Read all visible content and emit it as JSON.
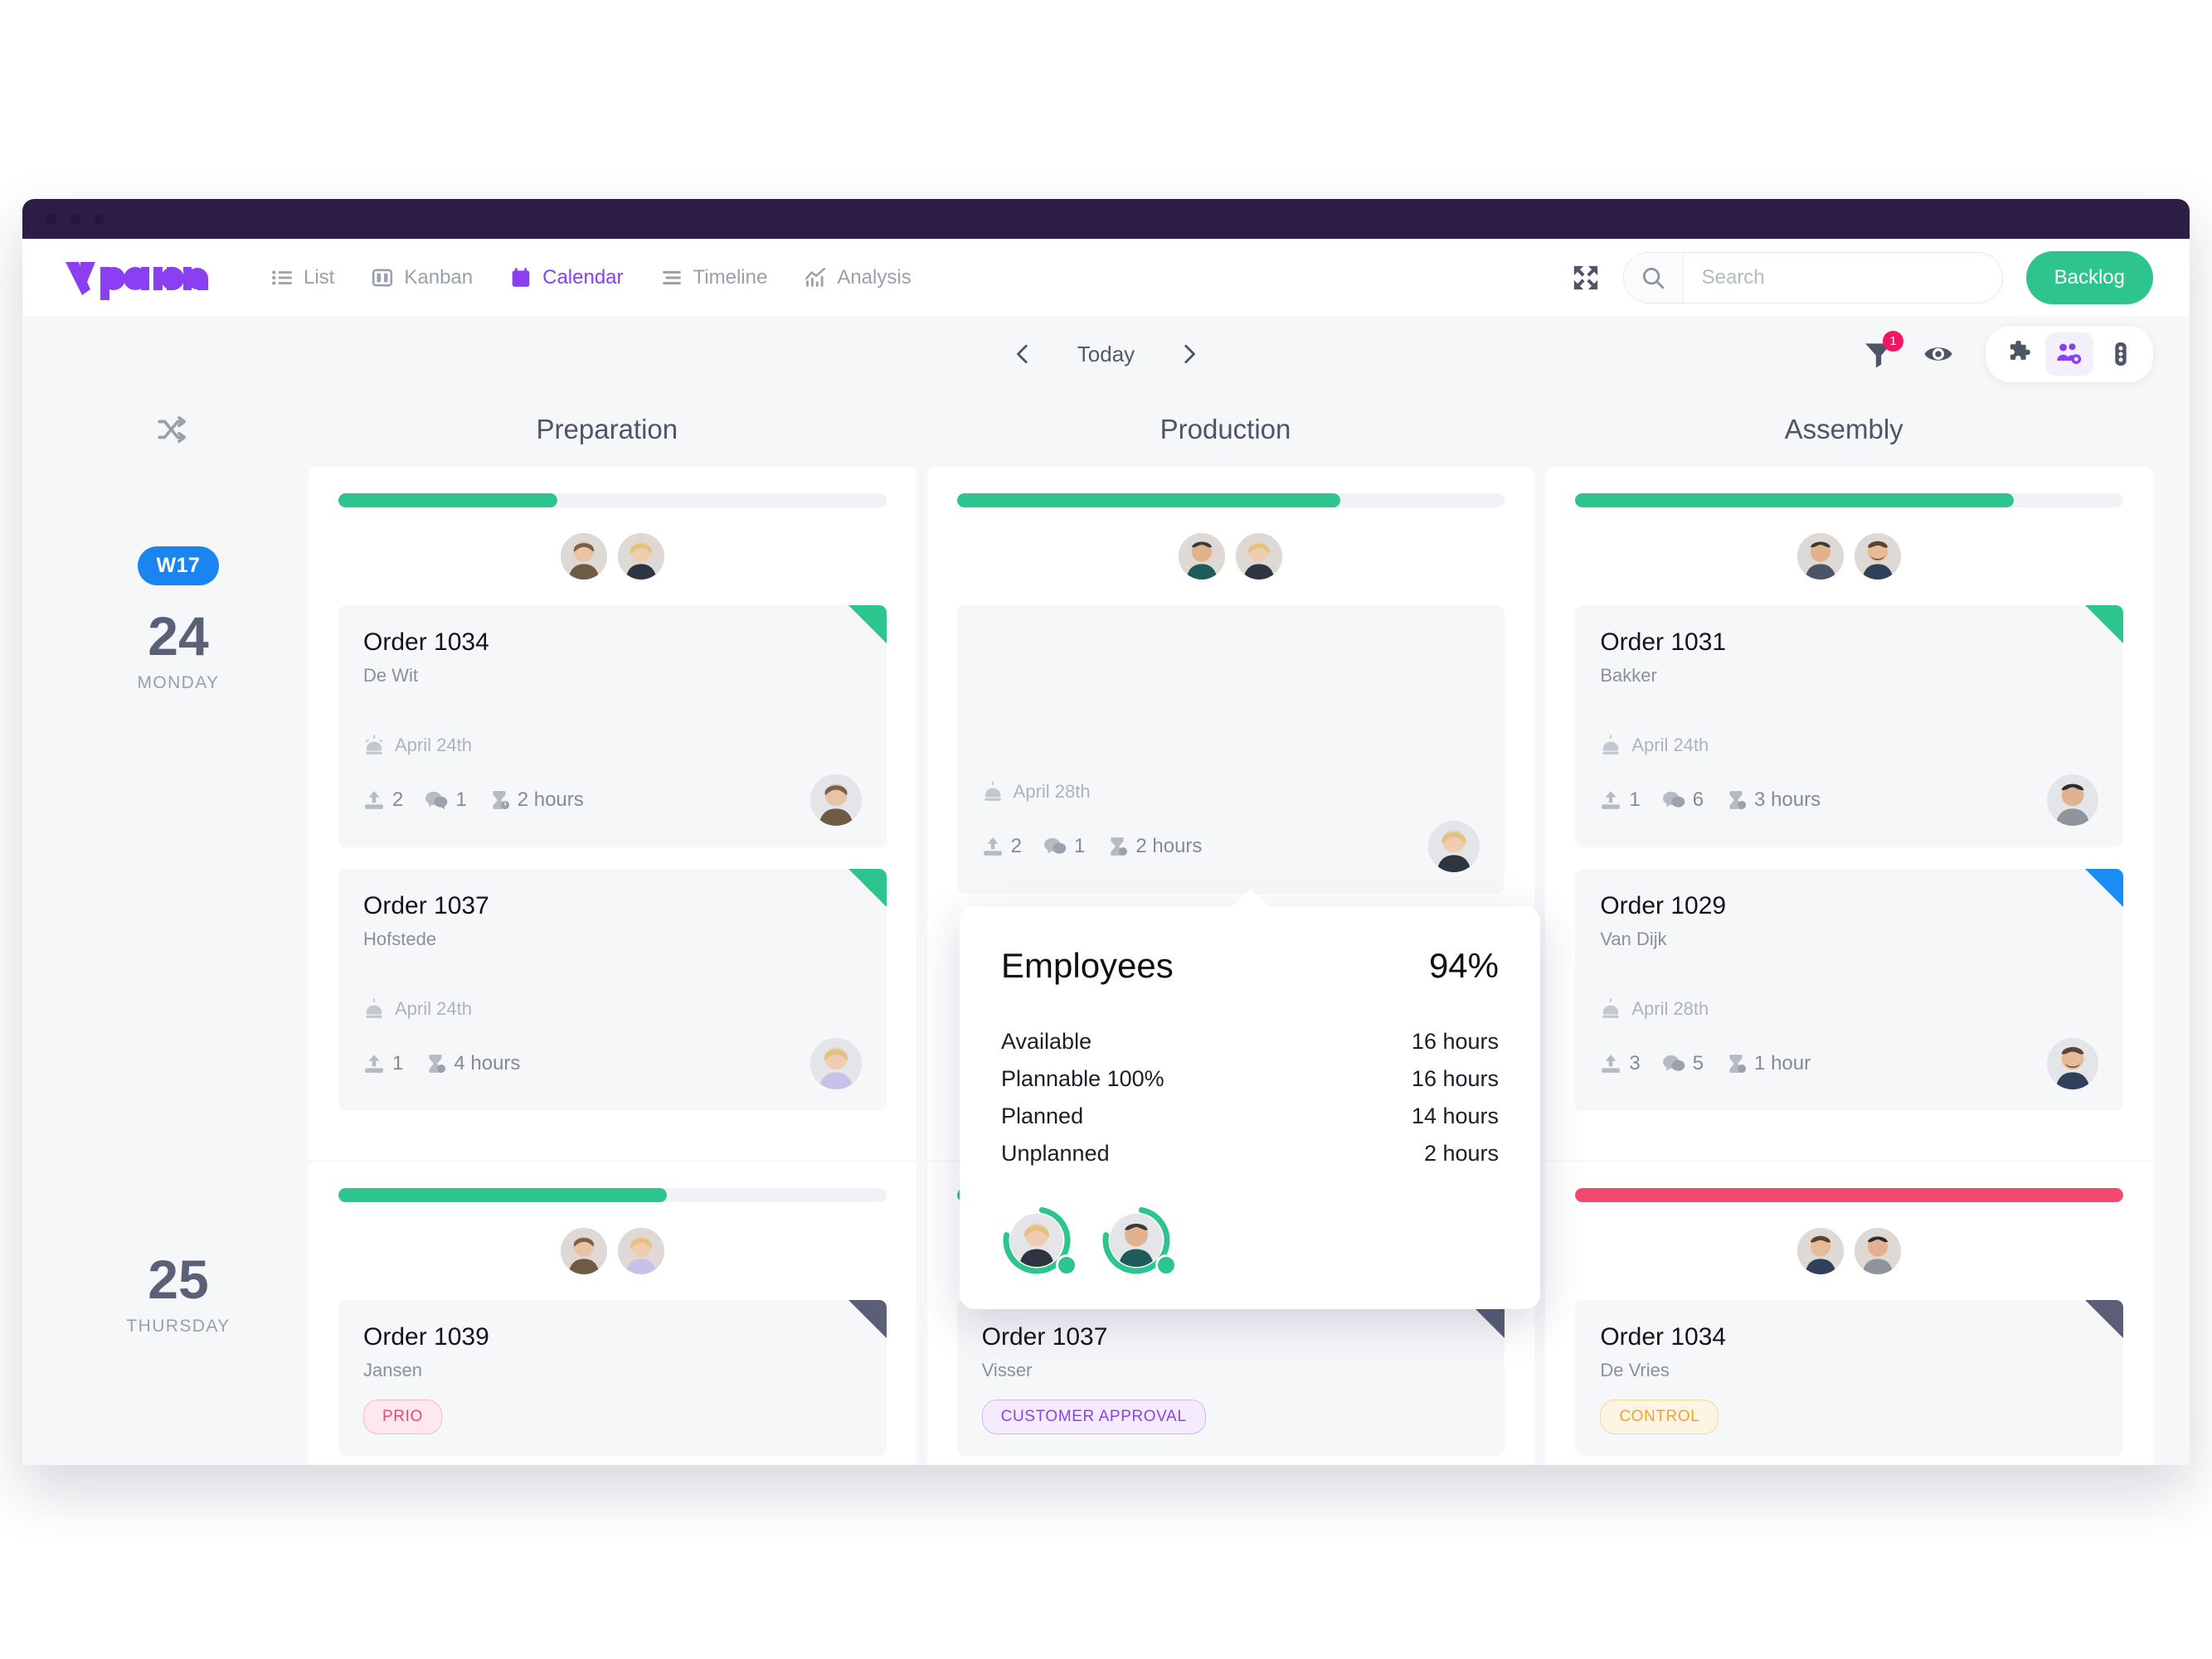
{
  "app": {
    "logo_text": "vplan",
    "nav": [
      {
        "label": "List",
        "icon": "list-icon",
        "active": false
      },
      {
        "label": "Kanban",
        "icon": "kanban-icon",
        "active": false
      },
      {
        "label": "Calendar",
        "icon": "calendar-icon",
        "active": true
      },
      {
        "label": "Timeline",
        "icon": "timeline-icon",
        "active": false
      },
      {
        "label": "Analysis",
        "icon": "analysis-icon",
        "active": false
      }
    ],
    "expand_icon": "expand-icon",
    "search": {
      "placeholder": "Search",
      "value": "",
      "icon": "search-icon"
    },
    "backlog_label": "Backlog"
  },
  "toolbar": {
    "prev_icon": "chevron-left-icon",
    "today_label": "Today",
    "next_icon": "chevron-right-icon",
    "filter_icon": "filter-icon",
    "filter_badge": "1",
    "eye_icon": "eye-icon",
    "puzzle_icon": "puzzle-icon",
    "people_icon": "people-gear-icon",
    "trafficlight_icon": "traffic-light-icon",
    "active_tool": "people-gear-icon"
  },
  "board": {
    "shuffle_icon": "shuffle-icon",
    "columns": [
      "Preparation",
      "Production",
      "Assembly"
    ],
    "days": [
      {
        "week": "W17",
        "number": "24",
        "name": "MONDAY"
      },
      {
        "week": "",
        "number": "25",
        "name": "THURSDAY"
      }
    ],
    "rows": [
      {
        "cells": [
          {
            "progress": {
              "percent": 40,
              "color": "#2ec48d"
            },
            "avatars": [
              "woman-brown",
              "woman-blonde"
            ],
            "cards": [
              {
                "title": "Order 1034",
                "sub": "De Wit",
                "ribbon": "green",
                "date": "April 24th",
                "uploads": "2",
                "comments": "1",
                "hours": "2 hours",
                "avatar": "woman-brown"
              },
              {
                "title": "Order 1037",
                "sub": "Hofstede",
                "ribbon": "green",
                "date": "April 24th",
                "uploads": "1",
                "comments": "",
                "hours": "4 hours",
                "avatar": "woman-blonde"
              }
            ]
          },
          {
            "progress": {
              "percent": 70,
              "color": "#2ec48d"
            },
            "avatars": [
              "man-dark",
              "woman-blonde"
            ],
            "cards": [
              {
                "title": "",
                "sub": "",
                "ribbon": "none",
                "date": "April 28th",
                "uploads": "2",
                "comments": "1",
                "hours": "2 hours",
                "avatar": "woman-blonde"
              }
            ]
          },
          {
            "progress": {
              "percent": 80,
              "color": "#2ec48d"
            },
            "avatars": [
              "man-dark",
              "man-beard"
            ],
            "cards": [
              {
                "title": "Order 1031",
                "sub": "Bakker",
                "ribbon": "green",
                "date": "April 24th",
                "uploads": "1",
                "comments": "6",
                "hours": "3 hours",
                "avatar": "man-dark"
              },
              {
                "title": "Order 1029",
                "sub": "Van Dijk",
                "ribbon": "blue",
                "date": "April 28th",
                "uploads": "3",
                "comments": "5",
                "hours": "1 hour",
                "avatar": "man-beard"
              }
            ]
          }
        ]
      },
      {
        "cells": [
          {
            "progress": {
              "percent": 60,
              "color": "#2ec48d"
            },
            "avatars": [
              "woman-brown",
              "woman-blonde"
            ],
            "cards": [
              {
                "title": "Order 1039",
                "sub": "Jansen",
                "ribbon": "slate",
                "tag": "PRIO",
                "tag_style": "prio"
              }
            ]
          },
          {
            "progress": {
              "percent": 36,
              "color": "#2ec48d"
            },
            "avatars": [
              "man-dark",
              "woman-blonde"
            ],
            "cards": [
              {
                "title": "Order 1037",
                "sub": "Visser",
                "ribbon": "slate",
                "tag": "CUSTOMER APPROVAL",
                "tag_style": "approv"
              }
            ]
          },
          {
            "progress": {
              "percent": 100,
              "color": "#f4486f"
            },
            "avatars": [
              "man-beard",
              "man-dark"
            ],
            "cards": [
              {
                "title": "Order 1034",
                "sub": "De Vries",
                "ribbon": "slate",
                "tag": "CONTROL",
                "tag_style": "ctrl"
              }
            ]
          }
        ]
      }
    ]
  },
  "popover": {
    "title": "Employees",
    "percent": "94%",
    "rows": [
      {
        "label": "Available",
        "value": "16 hours"
      },
      {
        "label": "Plannable 100%",
        "value": "16 hours"
      },
      {
        "label": "Planned",
        "value": "14 hours"
      },
      {
        "label": "Unplanned",
        "value": "2 hours"
      }
    ],
    "employees": [
      {
        "avatar": "woman-blonde",
        "ring": 75,
        "status": "#2ec48d"
      },
      {
        "avatar": "man-dark",
        "ring": 75,
        "status": "#2ec48d"
      }
    ]
  }
}
